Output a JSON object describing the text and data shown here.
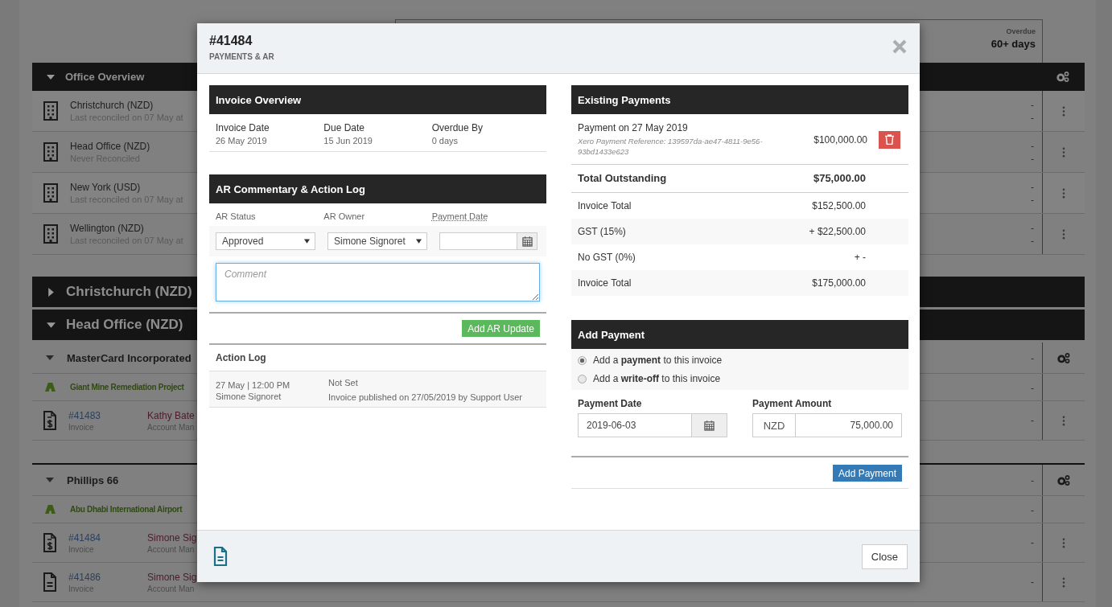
{
  "page": {
    "overdue_header": {
      "label": "Overdue",
      "value": "60+ days"
    },
    "office_overview": {
      "title": "Office Overview",
      "expanded": true,
      "offices": [
        {
          "name": "Christchurch (NZD)",
          "note": "Last reconciled on 07 May at",
          "values": [
            "-",
            "-"
          ]
        },
        {
          "name": "Head Office (NZD)",
          "note": "Never Reconciled",
          "values": [
            "-",
            "-"
          ]
        },
        {
          "name": "New York (USD)",
          "note": "Last reconciled on 07 May at",
          "values": [
            "-",
            "-"
          ]
        },
        {
          "name": "Wellington (NZD)",
          "note": "Last reconciled on 07 May at",
          "values": [
            "-",
            "-"
          ]
        }
      ]
    },
    "groups": [
      {
        "title": "Christchurch (NZD)",
        "expanded": false
      },
      {
        "title": "Head Office (NZD)",
        "expanded": true,
        "clients": [
          {
            "name": "MasterCard Incorporated",
            "expanded": true,
            "value": "-",
            "project": {
              "name": "Giant Mine Remediation Project",
              "value": "-"
            },
            "invoices": [
              {
                "kind": "billed",
                "number": "#41483",
                "type": "Invoice",
                "person": "Kathy Bate",
                "role": "Account Man",
                "value": "-"
              }
            ]
          },
          {
            "name": "Phillips 66",
            "expanded": true,
            "value": "-",
            "project": {
              "name": "Abu Dhabi International Airport",
              "value": "-"
            },
            "invoices": [
              {
                "kind": "billed",
                "number": "#41484",
                "type": "Invoice",
                "person": "Simone Sig",
                "role": "Account Man",
                "value": "-"
              },
              {
                "kind": "plain",
                "number": "#41486",
                "type": "Invoice",
                "person": "Simone Sig",
                "role": "Account Man",
                "value": "-"
              }
            ]
          }
        ]
      }
    ]
  },
  "modal": {
    "title": "#41484",
    "subtitle": "PAYMENTS & AR",
    "invoice_overview": {
      "title": "Invoice Overview",
      "fields": [
        {
          "label": "Invoice Date",
          "value": "26 May 2019"
        },
        {
          "label": "Due Date",
          "value": "15 Jun 2019"
        },
        {
          "label": "Overdue By",
          "value": "0 days"
        }
      ]
    },
    "ar": {
      "title": "AR Commentary & Action Log",
      "status": {
        "label": "AR Status",
        "value": "Approved"
      },
      "owner": {
        "label": "AR Owner",
        "value": "Simone Signoret"
      },
      "payment_date": {
        "label": "Payment Date"
      },
      "comment": {
        "placeholder": "Comment"
      },
      "button": "Add AR Update",
      "log_title": "Action Log",
      "log": [
        {
          "when": "27 May | 12:00 PM",
          "who": "Simone Signoret",
          "status": "Not Set",
          "message": "Invoice published on 27/05/2019 by Support User"
        }
      ]
    },
    "existing": {
      "title": "Existing Payments",
      "payments": [
        {
          "title": "Payment on 27 May 2019",
          "reference": "Xero Payment Reference: 139597da-ae47-4811-9e56-93bd1433e623",
          "amount": "$100,000.00"
        }
      ],
      "total": {
        "label": "Total Outstanding",
        "value": "$75,000.00"
      },
      "lines": [
        {
          "label": "Invoice Total",
          "value": "$152,500.00"
        },
        {
          "label": "GST (15%)",
          "value": "+ $22,500.00"
        },
        {
          "label": "No GST (0%)",
          "value": "+ -"
        },
        {
          "label": "Invoice Total",
          "value": "$175,000.00"
        }
      ]
    },
    "add_payment": {
      "title": "Add Payment",
      "options": [
        {
          "text": "Add a **payment** to this invoice",
          "selected": true
        },
        {
          "text": "Add a **write-off** to this invoice",
          "selected": false
        }
      ],
      "date": {
        "label": "Payment Date",
        "value": "2019-06-03"
      },
      "amount": {
        "label": "Payment Amount",
        "currency": "NZD",
        "value": "75,000.00"
      },
      "button": "Add Payment"
    },
    "close_button": "Close"
  }
}
